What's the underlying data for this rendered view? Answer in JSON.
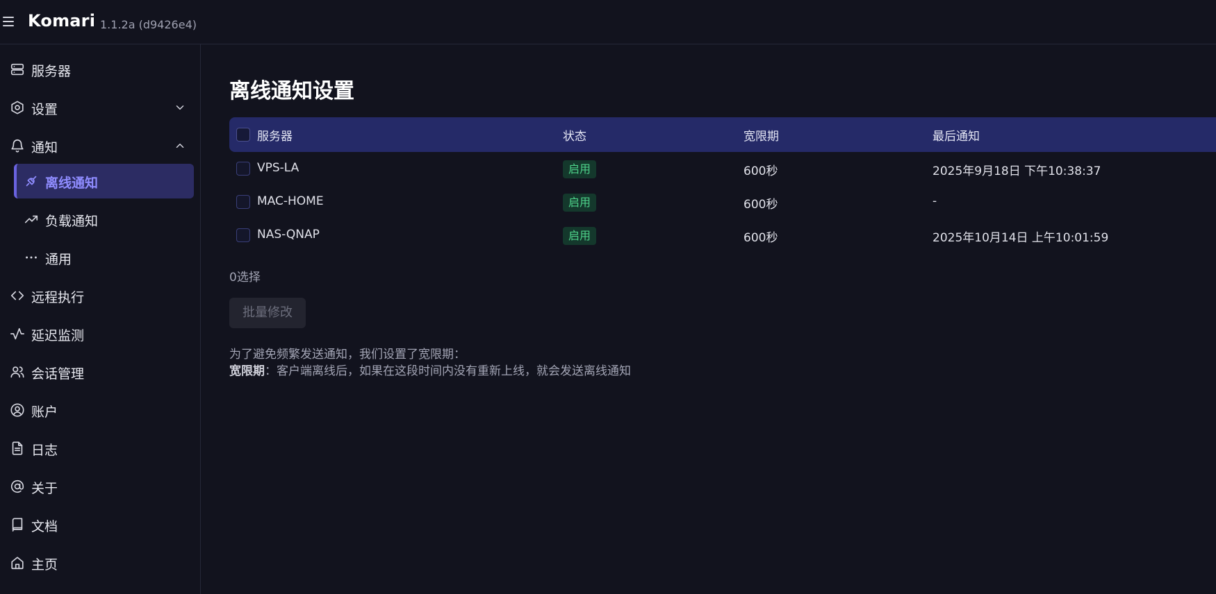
{
  "app": {
    "name": "Komari",
    "version": "1.1.2a (d9426e4)"
  },
  "sidebar": {
    "items": [
      {
        "label": "服务器",
        "icon": "server-icon"
      },
      {
        "label": "设置",
        "icon": "settings-icon",
        "chevron": "chevron-down-icon"
      },
      {
        "label": "通知",
        "icon": "bell-icon",
        "chevron": "chevron-up-icon"
      },
      {
        "label": "离线通知",
        "icon": "plug-icon",
        "active": true
      },
      {
        "label": "负载通知",
        "icon": "trend-up-icon"
      },
      {
        "label": "通用",
        "icon": "ellipsis-icon"
      },
      {
        "label": "远程执行",
        "icon": "code-icon"
      },
      {
        "label": "延迟监测",
        "icon": "activity-icon"
      },
      {
        "label": "会话管理",
        "icon": "users-icon"
      },
      {
        "label": "账户",
        "icon": "user-circle-icon"
      },
      {
        "label": "日志",
        "icon": "file-text-icon"
      },
      {
        "label": "关于",
        "icon": "at-sign-icon"
      },
      {
        "label": "文档",
        "icon": "book-icon"
      },
      {
        "label": "主页",
        "icon": "home-icon"
      }
    ]
  },
  "main": {
    "title": "离线通知设置",
    "table": {
      "headers": {
        "server": "服务器",
        "status": "状态",
        "grace": "宽限期",
        "last": "最后通知"
      },
      "rows": [
        {
          "server": "VPS-LA",
          "status": "启用",
          "grace": "600秒",
          "last": "2025年9月18日 下午10:38:37"
        },
        {
          "server": "MAC-HOME",
          "status": "启用",
          "grace": "600秒",
          "last": "-"
        },
        {
          "server": "NAS-QNAP",
          "status": "启用",
          "grace": "600秒",
          "last": "2025年10月14日 上午10:01:59"
        }
      ]
    },
    "selected_count": "0选择",
    "bulk_edit_label": "批量修改",
    "note_line1": "为了避免频繁发送通知，我们设置了宽限期：",
    "note_term": "宽限期",
    "note_line2": "：客户端离线后，如果在这段时间内没有重新上线，就会发送离线通知"
  },
  "colors": {
    "background": "#12131e",
    "header_row": "#252a68",
    "active_nav": "#2c2c63",
    "accent": "#8f8cff",
    "status_enabled": "#4ed28a"
  }
}
